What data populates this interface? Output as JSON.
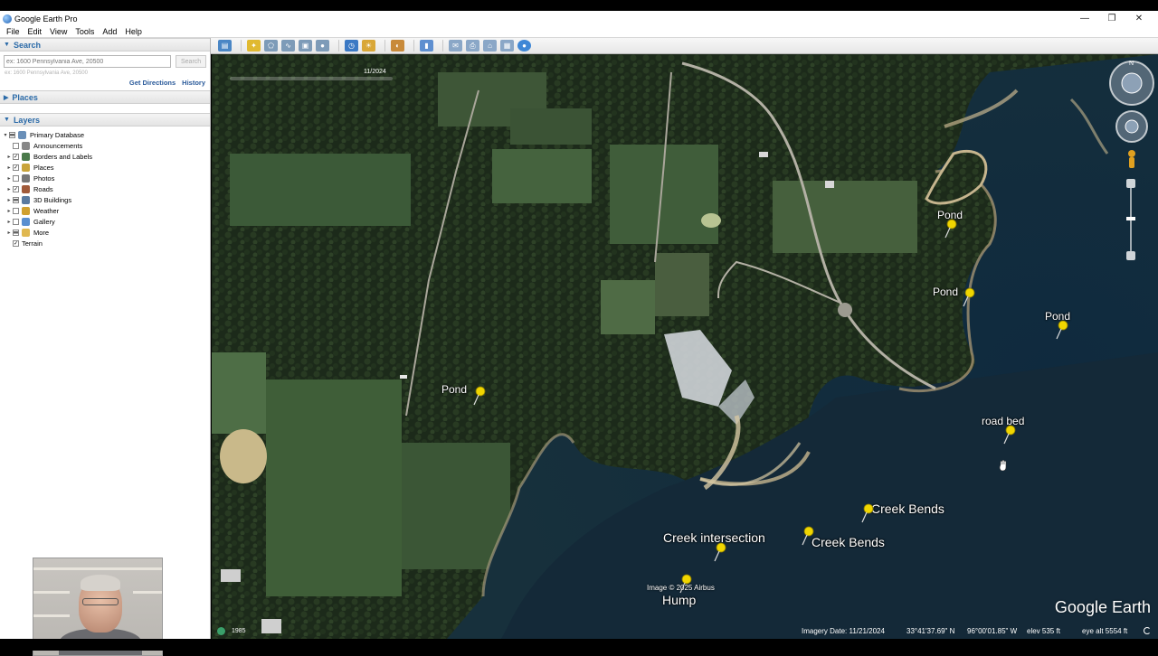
{
  "window": {
    "title": "Google Earth Pro",
    "controls": [
      "—",
      "❐",
      "✕"
    ]
  },
  "menu": [
    "File",
    "Edit",
    "View",
    "Tools",
    "Add",
    "Help"
  ],
  "search": {
    "header": "Search",
    "placeholder": "ex: 1600 Pennsylvania Ave, 20500",
    "button": "Search",
    "links": [
      "Get Directions",
      "History"
    ]
  },
  "places": {
    "header": "Places"
  },
  "layers": {
    "header": "Layers",
    "items": [
      {
        "label": "Primary Database",
        "checked": "partial",
        "expandable": true,
        "icon": "database-icon"
      },
      {
        "label": "Announcements",
        "checked": "none",
        "expandable": false,
        "icon": "mail-icon"
      },
      {
        "label": "Borders and Labels",
        "checked": "yes",
        "expandable": true,
        "icon": "flag-icon"
      },
      {
        "label": "Places",
        "checked": "yes",
        "expandable": true,
        "icon": "places-icon"
      },
      {
        "label": "Photos",
        "checked": "none",
        "expandable": true,
        "icon": "camera-icon"
      },
      {
        "label": "Roads",
        "checked": "yes",
        "expandable": true,
        "icon": "road-icon"
      },
      {
        "label": "3D Buildings",
        "checked": "partial",
        "expandable": true,
        "icon": "building-icon"
      },
      {
        "label": "Weather",
        "checked": "none",
        "expandable": true,
        "icon": "weather-icon"
      },
      {
        "label": "Gallery",
        "checked": "none",
        "expandable": true,
        "icon": "gallery-icon"
      },
      {
        "label": "More",
        "checked": "partial",
        "expandable": true,
        "icon": "folder-icon"
      },
      {
        "label": "Terrain",
        "checked": "yes",
        "expandable": false,
        "icon": ""
      }
    ]
  },
  "map": {
    "time_label": "11/2024",
    "placemarks": [
      {
        "label": "Pond"
      },
      {
        "label": "Pond"
      },
      {
        "label": "Pond"
      },
      {
        "label": "Pond"
      },
      {
        "label": "road bed"
      },
      {
        "label": "Creek Bends"
      },
      {
        "label": "Creek Bends"
      },
      {
        "label": "Creek intersection"
      },
      {
        "label": "Hump"
      }
    ],
    "credit": "Image © 2025 Airbus",
    "logo": "Google Earth",
    "status": {
      "year": "1985",
      "imagery_date": "Imagery Date: 11/21/2024",
      "lat": "33°41'37.69\" N",
      "lon": "96°00'01.85\" W",
      "elev": "elev   535 ft",
      "eye_alt": "eye alt   5554 ft"
    }
  }
}
